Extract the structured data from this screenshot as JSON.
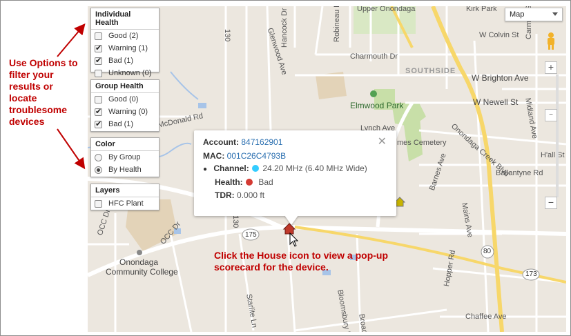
{
  "panels": {
    "individual_health": {
      "title": "Individual Health",
      "items": [
        {
          "label": "Good (2)",
          "checked": false
        },
        {
          "label": "Warning (1)",
          "checked": true
        },
        {
          "label": "Bad (1)",
          "checked": true
        },
        {
          "label": "Unknown (0)",
          "checked": false
        }
      ]
    },
    "group_health": {
      "title": "Group Health",
      "items": [
        {
          "label": "Good (0)",
          "checked": false
        },
        {
          "label": "Warning (0)",
          "checked": true
        },
        {
          "label": "Bad (1)",
          "checked": true
        }
      ]
    },
    "color": {
      "title": "Color",
      "items": [
        {
          "label": "By Group",
          "selected": false
        },
        {
          "label": "By Health",
          "selected": true
        }
      ]
    },
    "layers": {
      "title": "Layers",
      "items": [
        {
          "label": "HFC Plant",
          "checked": false
        }
      ]
    }
  },
  "annotations": {
    "options_note": [
      "Use Options to",
      "filter your",
      "results or",
      "locate",
      "troublesome",
      "devices"
    ],
    "house_note": [
      "Click the House icon to view a pop-up",
      "scorecard for the device."
    ]
  },
  "popup": {
    "account_label": "Account:",
    "account_value": "847162901",
    "mac_label": "MAC:",
    "mac_value": "001C26C4793B",
    "channel_label": "Channel:",
    "channel_value": "24.20 MHz (6.40 MHz Wide)",
    "channel_color": "#33ccff",
    "health_label": "Health:",
    "health_value": "Bad",
    "health_color": "#d43a33",
    "tdr_label": "TDR:",
    "tdr_value": "0.000 ft",
    "close_symbol": "✕"
  },
  "map_type": {
    "selected": "Map"
  },
  "zoom": {
    "in": "+",
    "out": "−",
    "mid": "−"
  },
  "map_labels": {
    "upper_onondaga": "Upper Onondaga",
    "kirk_park": "Kirk Park",
    "carmon_st": "Carmon St",
    "w_colvin_st": "W Colvin St",
    "hancock_dr": "Hancock Dr",
    "glenwood_ave": "Glenwood Ave",
    "robineau_rd": "Robineau Rd",
    "charmouth_dr": "Charmouth Dr",
    "southside": "SOUTHSIDE",
    "w_brighton_ave": "W Brighton Ave",
    "elmwood_park": "Elmwood Park",
    "w_newell_st": "W Newell St",
    "midland_ave": "Midland Ave",
    "mcdonald_rd": "McDonald Rd",
    "lynch_ave": "Lynch Ave",
    "cemetery": "mes Cemetery",
    "onondaga_creek_blvd": "Onondaga Creek Blvd",
    "barnes_ave": "Barnes Ave",
    "ballantyne_rd": "Ballantyne Rd",
    "hall_st": "H'all St",
    "mains_ave": "Mains Ave",
    "occ_dr1": "OCC Dr",
    "occ_dr2": "OCC Dr",
    "route_175": "175",
    "route_173": "173",
    "route_80": "80",
    "route_130a": "130",
    "route_130b": "130",
    "onondaga_cc_1": "Onondaga",
    "onondaga_cc_2": "Community College",
    "starlite_ln": "Starlite Ln",
    "bloomsbury_dr": "Bloomsbury Dr",
    "broad": "Broad",
    "hopper_rd": "Hopper Rd",
    "chaffee_ave": "Chaffee Ave",
    "route_80_label": "80"
  },
  "colors": {
    "annotation": "#c00000",
    "map_bg": "#ece7df",
    "park": "#c8dfa8",
    "water": "#a7c4e8",
    "highway": "#f7d76a",
    "house_bad": "#c0392b",
    "house_good": "#c8b400"
  }
}
